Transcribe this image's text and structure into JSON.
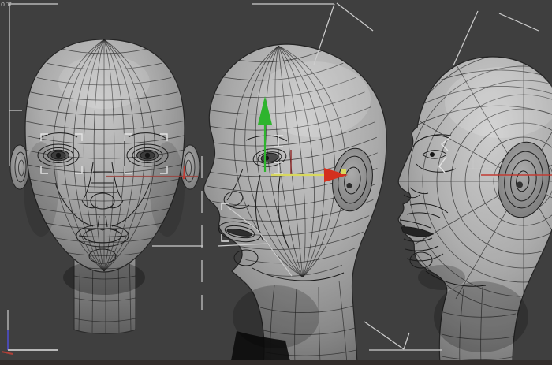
{
  "viewport": {
    "label_fragment": "ont",
    "background_color": "#3f3f3f"
  },
  "colors": {
    "guide": "#cdcdcd",
    "bracket": "#e3e3e3",
    "gizmo_green": "#2db42d",
    "gizmo_red": "#d3301e",
    "gizmo_red_dim": "#8e2020",
    "gizmo_yellow": "#d8d85e",
    "scan_red": "#c23b32",
    "scan_red_dim": "#9a423c",
    "axis_blue": "#4a4ab0",
    "axis_red": "#b04038",
    "axis_gray": "#b8b8b8",
    "bottom_edge": "#322d2b"
  }
}
